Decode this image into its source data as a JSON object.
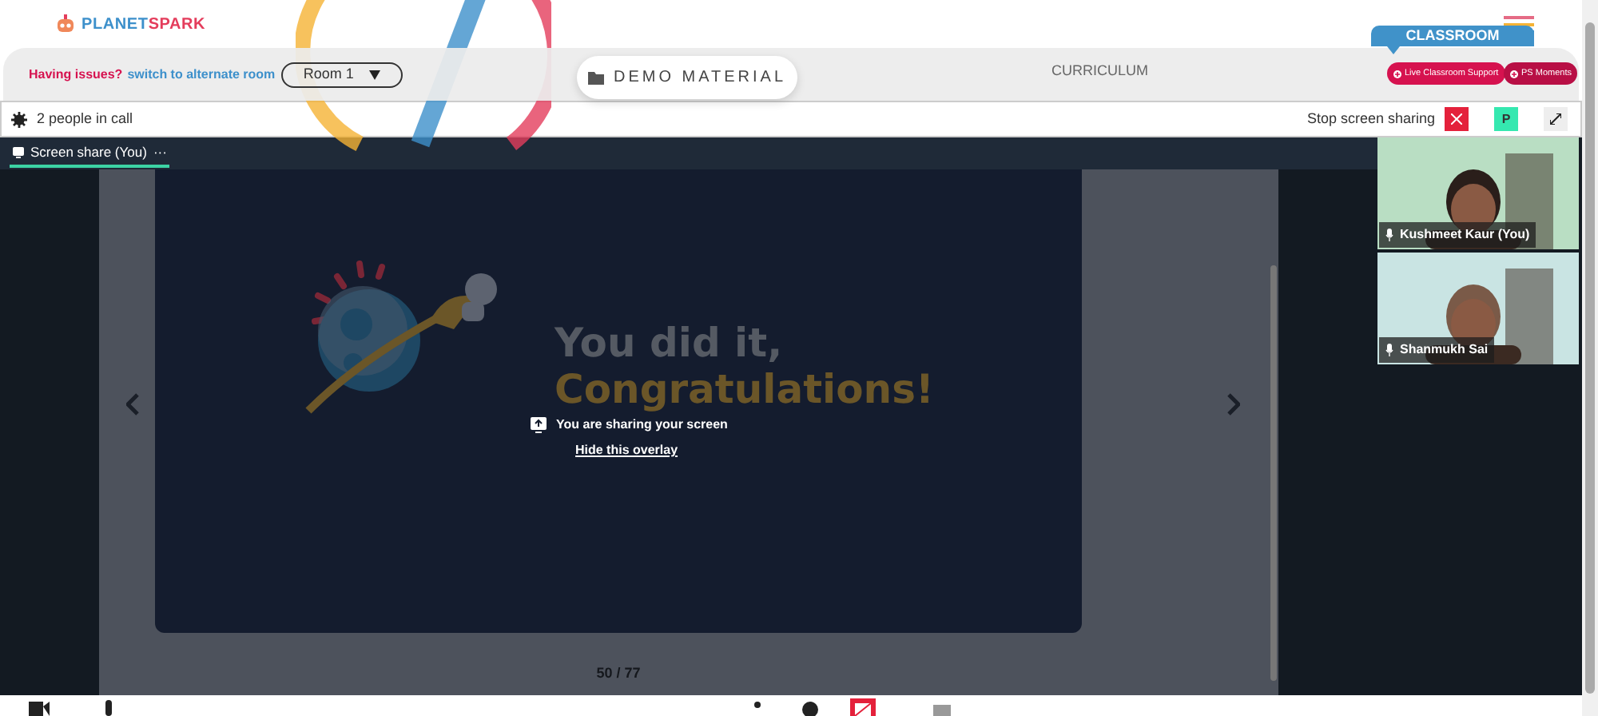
{
  "header": {
    "logo": {
      "first": "PLANET",
      "second": "SPARK"
    }
  },
  "toolbar": {
    "issue_text": "Having issues?",
    "switch_link": "switch to alternate room",
    "room_select": "Room 1",
    "demo_button": "DEMO MATERIAL",
    "curriculum_tab": "CURRICULUM",
    "classroom_tab": "CLASSROOM",
    "action_buttons": [
      "Live Classroom Support",
      "PS Moments"
    ]
  },
  "call_bar": {
    "people": "2 people in call",
    "stop_label": "Stop screen sharing",
    "avatar": "P"
  },
  "share_tab": {
    "label": "Screen share (You)",
    "menu": "···",
    "selected": true
  },
  "slide": {
    "line_1": "You did it,",
    "line_2": "Congratulations!",
    "overlay_text": "You are sharing your screen",
    "overlay_link": "Hide this overlay",
    "page": "50 / 77"
  },
  "participants": [
    {
      "name": "Kushmeet Kaur (You)",
      "kind": "picture"
    },
    {
      "name": "Shanmukh Sai",
      "kind": "picture"
    }
  ]
}
